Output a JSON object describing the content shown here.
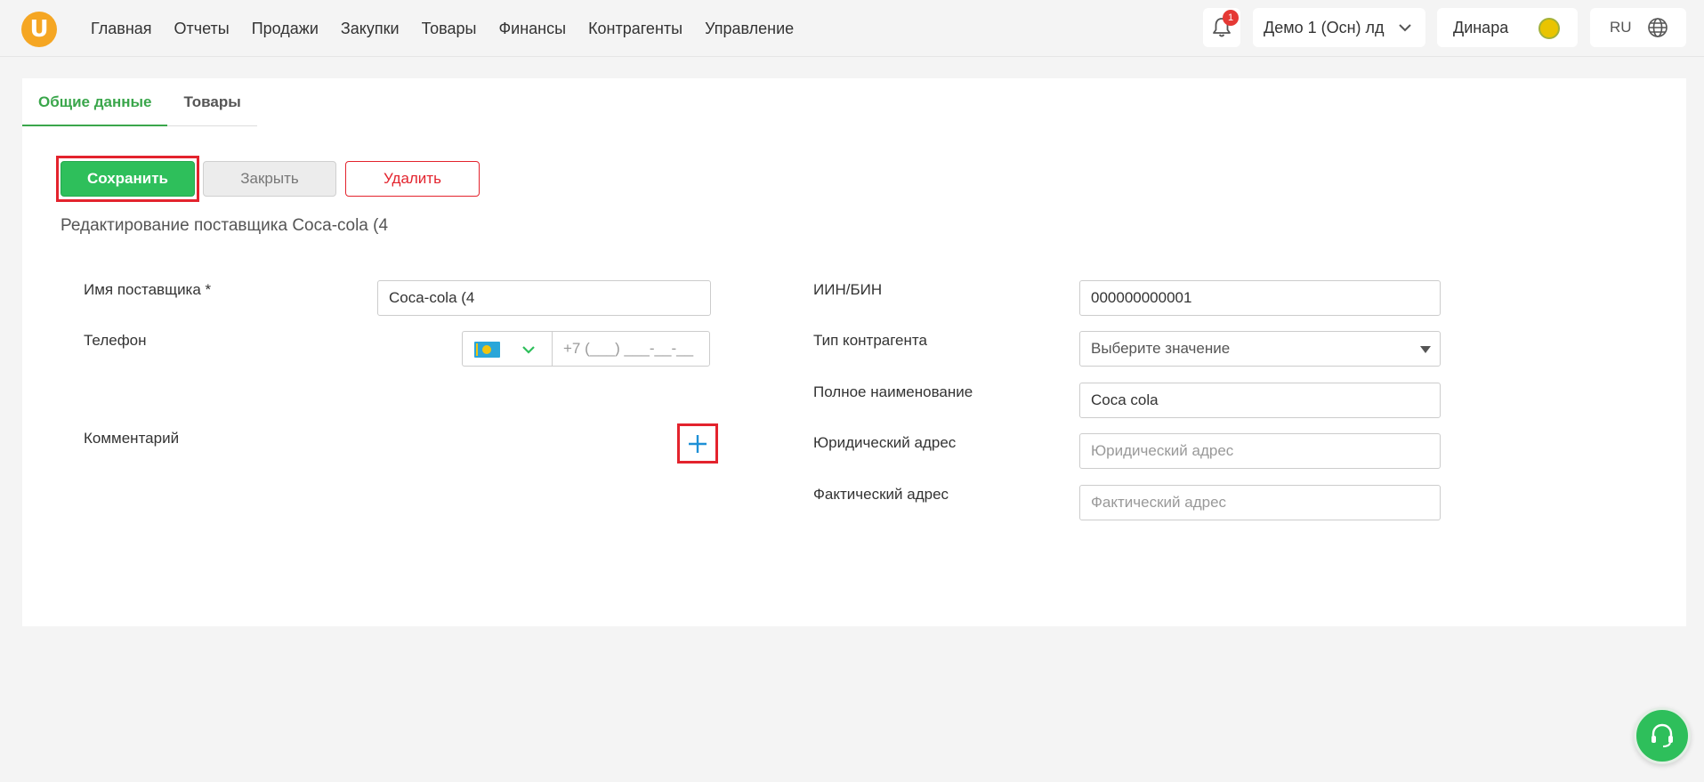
{
  "header": {
    "logo_letter": "U",
    "nav": [
      "Главная",
      "Отчеты",
      "Продажи",
      "Закупки",
      "Товары",
      "Финансы",
      "Контрагенты",
      "Управление"
    ],
    "notifications_count": "1",
    "company": "Демо 1 (Осн) лд",
    "user": "Динара",
    "language": "RU"
  },
  "tabs": [
    "Общие данные",
    "Товары"
  ],
  "actions": {
    "save": "Сохранить",
    "close": "Закрыть",
    "delete": "Удалить"
  },
  "page_title": "Редактирование поставщика Coca-cola (4",
  "form_left": {
    "supplier_name_label": "Имя поставщика *",
    "supplier_name_value": "Coca-cola (4",
    "phone_label": "Телефон",
    "phone_placeholder": "+7 (___) ___-__-__",
    "comment_label": "Комментарий"
  },
  "form_right": {
    "iin_label": "ИИН/БИН",
    "iin_value": "000000000001",
    "type_label": "Тип контрагента",
    "type_placeholder": "Выберите значение",
    "full_name_label": "Полное наименование",
    "full_name_value": "Coca cola",
    "legal_address_label": "Юридический адрес",
    "legal_address_placeholder": "Юридический адрес",
    "actual_address_label": "Фактический адрес",
    "actual_address_placeholder": "Фактический адрес"
  },
  "colors": {
    "accent_green": "#2ebf5b",
    "highlight_red": "#e3232d",
    "plus_blue": "#1e90d6"
  }
}
